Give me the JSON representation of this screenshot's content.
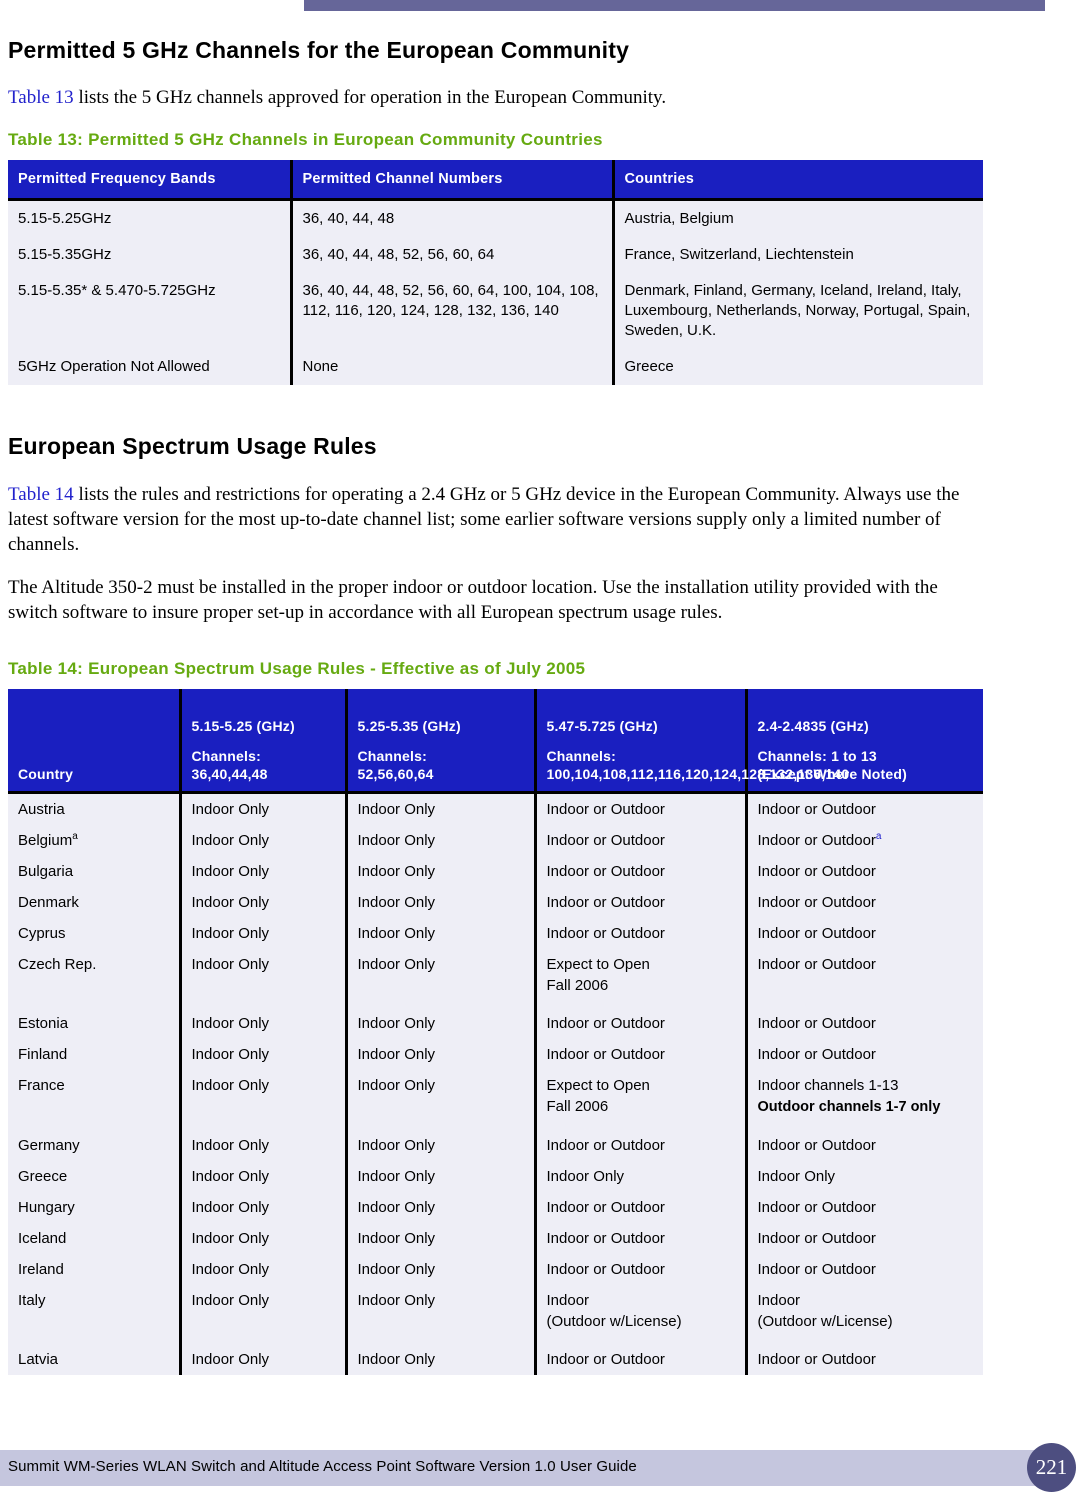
{
  "document": {
    "footer_text": "Summit WM-Series WLAN Switch and Altitude Access Point Software Version 1.0 User Guide",
    "page_number": "221"
  },
  "section_1": {
    "heading": "Permitted 5 GHz Channels for the European Community",
    "intro_link": "Table 13",
    "intro_rest": " lists the 5 GHz channels approved for operation in the European Community.",
    "table_caption": "Table 13:  Permitted 5 GHz Channels in European Community Countries"
  },
  "table_13": {
    "headers": [
      "Permitted Frequency Bands",
      "Permitted Channel Numbers",
      "Countries"
    ],
    "rows": [
      {
        "band": "5.15-5.25GHz",
        "channels": "36, 40, 44, 48",
        "countries": "Austria, Belgium"
      },
      {
        "band": "5.15-5.35GHz",
        "channels": "36, 40, 44, 48, 52, 56, 60, 64",
        "countries": "France, Switzerland, Liechtenstein"
      },
      {
        "band": "5.15-5.35* & 5.470-5.725GHz",
        "channels": "36, 40, 44, 48, 52, 56, 60, 64, 100, 104, 108, 112, 116, 120, 124, 128, 132, 136, 140",
        "countries": "Denmark, Finland, Germany, Iceland, Ireland, Italy, Luxembourg, Netherlands, Norway, Portugal, Spain, Sweden, U.K."
      },
      {
        "band": "5GHz Operation Not Allowed",
        "channels": "None",
        "countries": "Greece"
      }
    ]
  },
  "section_2": {
    "heading": "European Spectrum Usage Rules",
    "para1_link": "Table 14",
    "para1_rest": " lists the rules and restrictions for operating a 2.4 GHz or 5 GHz device in the European Community. Always use the latest software version for the most up-to-date channel list; some earlier software versions supply only a limited number of channels.",
    "para2": "The Altitude 350-2 must be installed in the proper indoor or outdoor location. Use the installation utility provided with the switch software to insure proper set-up in accordance with all European spectrum usage rules.",
    "table_caption": "Table 14:  European Spectrum Usage Rules - Effective as of July 2005"
  },
  "table_14": {
    "headers": {
      "country": "Country",
      "col2_band": "5.15-5.25 (GHz)",
      "col2_channels_label": "Channels:",
      "col2_channels": "36,40,44,48",
      "col3_band": "5.25-5.35 (GHz)",
      "col3_channels_label": "Channels:",
      "col3_channels": "52,56,60,64",
      "col4_band": "5.47-5.725 (GHz)",
      "col4_channels_label": "Channels:",
      "col4_channels": "100,104,108,112,116,120,124,128,132,136,140",
      "col5_band": "2.4-2.4835 (GHz)",
      "col5_channels": "Channels: 1 to 13",
      "col5_note": "(Except Where Noted)"
    },
    "rows": [
      {
        "country": "Austria",
        "country_fn": "",
        "c2": "Indoor Only",
        "c3": "Indoor Only",
        "c4": "Indoor or Outdoor",
        "c5": "Indoor or Outdoor",
        "c5_fn": "",
        "c5_bold": ""
      },
      {
        "country": "Belgium",
        "country_fn": "a",
        "c2": "Indoor Only",
        "c3": "Indoor Only",
        "c4": "Indoor or Outdoor",
        "c5": "Indoor or Outdoor",
        "c5_fn": "a",
        "c5_bold": ""
      },
      {
        "country": "Bulgaria",
        "country_fn": "",
        "c2": "Indoor Only",
        "c3": "Indoor Only",
        "c4": "Indoor or Outdoor",
        "c5": "Indoor or Outdoor",
        "c5_fn": "",
        "c5_bold": ""
      },
      {
        "country": "Denmark",
        "country_fn": "",
        "c2": "Indoor Only",
        "c3": "Indoor Only",
        "c4": "Indoor or Outdoor",
        "c5": "Indoor or Outdoor",
        "c5_fn": "",
        "c5_bold": ""
      },
      {
        "country": "Cyprus",
        "country_fn": "",
        "c2": "Indoor Only",
        "c3": "Indoor Only",
        "c4": "Indoor or Outdoor",
        "c5": "Indoor or Outdoor",
        "c5_fn": "",
        "c5_bold": ""
      },
      {
        "country": "Czech Rep.",
        "country_fn": "",
        "c2": "Indoor Only",
        "c3": "Indoor Only",
        "c4": "Expect to Open\nFall 2006",
        "c5": "Indoor or Outdoor",
        "c5_fn": "",
        "c5_bold": ""
      },
      {
        "country": "Estonia",
        "country_fn": "",
        "c2": "Indoor Only",
        "c3": "Indoor Only",
        "c4": "Indoor or Outdoor",
        "c5": "Indoor or Outdoor",
        "c5_fn": "",
        "c5_bold": ""
      },
      {
        "country": "Finland",
        "country_fn": "",
        "c2": "Indoor Only",
        "c3": "Indoor Only",
        "c4": "Indoor or Outdoor",
        "c5": "Indoor or Outdoor",
        "c5_fn": "",
        "c5_bold": ""
      },
      {
        "country": "France",
        "country_fn": "",
        "c2": "Indoor Only",
        "c3": "Indoor Only",
        "c4": "Expect to Open\nFall 2006",
        "c5": "Indoor channels 1-13",
        "c5_fn": "",
        "c5_bold": "Outdoor channels 1-7 only"
      },
      {
        "country": "Germany",
        "country_fn": "",
        "c2": "Indoor Only",
        "c3": "Indoor Only",
        "c4": "Indoor or Outdoor",
        "c5": "Indoor or Outdoor",
        "c5_fn": "",
        "c5_bold": ""
      },
      {
        "country": "Greece",
        "country_fn": "",
        "c2": "Indoor Only",
        "c3": "Indoor Only",
        "c4": "Indoor Only",
        "c5": "Indoor Only",
        "c5_fn": "",
        "c5_bold": ""
      },
      {
        "country": "Hungary",
        "country_fn": "",
        "c2": "Indoor Only",
        "c3": "Indoor Only",
        "c4": "Indoor or Outdoor",
        "c5": "Indoor or Outdoor",
        "c5_fn": "",
        "c5_bold": ""
      },
      {
        "country": "Iceland",
        "country_fn": "",
        "c2": "Indoor Only",
        "c3": "Indoor Only",
        "c4": "Indoor or Outdoor",
        "c5": "Indoor or Outdoor",
        "c5_fn": "",
        "c5_bold": ""
      },
      {
        "country": "Ireland",
        "country_fn": "",
        "c2": "Indoor Only",
        "c3": "Indoor Only",
        "c4": "Indoor or Outdoor",
        "c5": "Indoor or Outdoor",
        "c5_fn": "",
        "c5_bold": ""
      },
      {
        "country": "Italy",
        "country_fn": "",
        "c2": "Indoor Only",
        "c3": "Indoor Only",
        "c4": "Indoor\n(Outdoor w/License)",
        "c5": "Indoor\n(Outdoor w/License)",
        "c5_fn": "",
        "c5_bold": ""
      },
      {
        "country": "Latvia",
        "country_fn": "",
        "c2": "Indoor Only",
        "c3": "Indoor Only",
        "c4": "Indoor or Outdoor",
        "c5": "Indoor or Outdoor",
        "c5_fn": "",
        "c5_bold": ""
      }
    ]
  }
}
